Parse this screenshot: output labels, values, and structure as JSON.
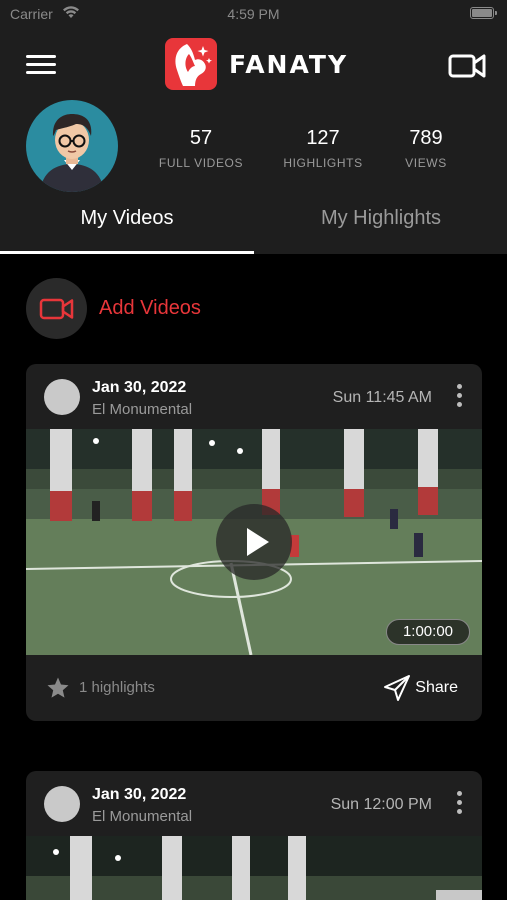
{
  "status_bar": {
    "carrier": "Carrier",
    "time": "4:59 PM"
  },
  "header": {
    "logo_text": "FANATY",
    "menu_icon": "hamburger-menu-icon",
    "camera_icon": "video-camera-icon"
  },
  "profile": {
    "stats": [
      {
        "value": "57",
        "label": "FULL VIDEOS"
      },
      {
        "value": "127",
        "label": "HIGHLIGHTS"
      },
      {
        "value": "789",
        "label": "VIEWS"
      }
    ]
  },
  "tabs": [
    {
      "label": "My Videos",
      "active": true
    },
    {
      "label": "My Highlights",
      "active": false
    }
  ],
  "add_videos": {
    "label": "Add Videos",
    "icon": "video-camera-icon"
  },
  "videos": [
    {
      "date": "Jan 30, 2022",
      "venue": "El Monumental",
      "when": "Sun 11:45 AM",
      "duration": "1:00:00",
      "highlights": "1 highlights",
      "share_label": "Share"
    },
    {
      "date": "Jan 30, 2022",
      "venue": "El Monumental",
      "when": "Sun 12:00 PM"
    }
  ],
  "colors": {
    "accent": "#e8363a",
    "header_bg": "#1e1e1e",
    "card_bg": "#1f1f1f",
    "muted": "#9a9a9a"
  }
}
